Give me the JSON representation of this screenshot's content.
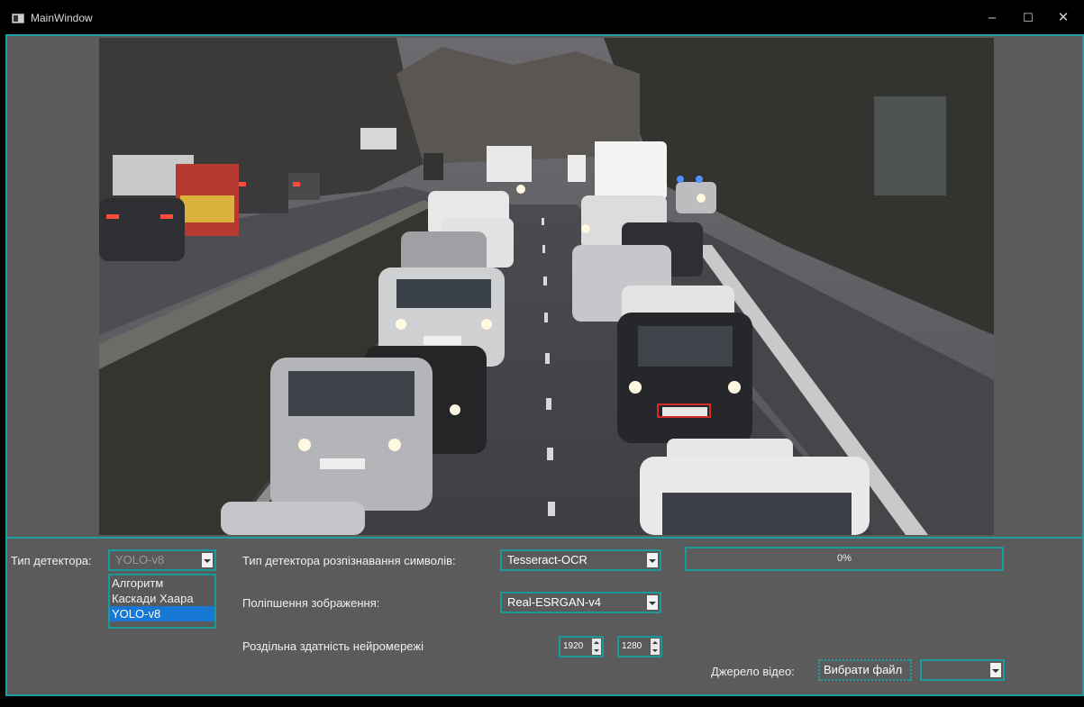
{
  "window": {
    "title": "MainWindow",
    "minimize_glyph": "–",
    "maximize_glyph": "☐",
    "close_glyph": "✕"
  },
  "video": {
    "plate_detection_color": "#d42a2a"
  },
  "controls": {
    "detector_type": {
      "label": "Тип детектора:",
      "selected": "YOLO-v8",
      "options": [
        "Алгоритм",
        "Каскади Хаара",
        "YOLO-v8"
      ],
      "expanded": true
    },
    "ocr_type": {
      "label": "Тип детектора розпізнавання символів:",
      "selected": "Tesseract-OCR"
    },
    "enhancement": {
      "label": "Поліпшення зображення:",
      "selected": "Real-ESRGAN-v4"
    },
    "resolution": {
      "label": "Роздільна здатність нейромережі",
      "width": "1920",
      "height": "1280"
    },
    "progress": {
      "value": 0,
      "text": "0%"
    },
    "source": {
      "label": "Джерело відео:",
      "button_label": "Вибрати файл",
      "selected": ""
    }
  },
  "colors": {
    "accent": "#1aa0a0",
    "selection": "#1677d4",
    "background": "#5b5b5b"
  }
}
